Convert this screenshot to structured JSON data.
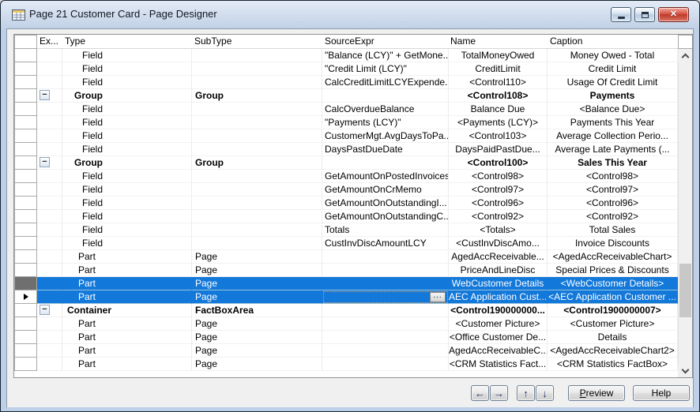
{
  "window": {
    "title": "Page 21 Customer Card - Page Designer"
  },
  "icons": {
    "app": "table-grid",
    "minimize": "minimize-bar",
    "restore": "restore-box",
    "close": "✕",
    "collapse": "−",
    "current_row": "right-triangle",
    "assist_edit": "...",
    "move_left": "←",
    "move_right": "→",
    "move_up": "↑",
    "move_down": "↓",
    "scroll_up": "chevron-up",
    "scroll_down": "chevron-down"
  },
  "colors": {
    "selection": "#1278da",
    "selection_text": "#ffffff",
    "titlebar_top": "#e3ebf6",
    "titlebar_bottom": "#c2d1e6",
    "frame": "#bdd0e7",
    "close_button": "#c73c2c",
    "client_bg": "#f0f0f0"
  },
  "grid": {
    "columns": [
      {
        "key": "ex",
        "label": "Ex..."
      },
      {
        "key": "type",
        "label": "Type"
      },
      {
        "key": "subtype",
        "label": "SubType"
      },
      {
        "key": "source",
        "label": "SourceExpr"
      },
      {
        "key": "name",
        "label": "Name"
      },
      {
        "key": "caption",
        "label": "Caption"
      }
    ],
    "rows": [
      {
        "type": "Field",
        "subtype": "",
        "source": "\"Balance (LCY)\" + GetMone...",
        "name": "TotalMoneyOwed",
        "caption": "Money Owed - Total"
      },
      {
        "type": "Field",
        "subtype": "",
        "source": "\"Credit Limit (LCY)\"",
        "name": "CreditLimit",
        "caption": "Credit Limit"
      },
      {
        "type": "Field",
        "subtype": "",
        "source": "CalcCreditLimitLCYExpende...",
        "name": "<Control110>",
        "caption": "Usage Of Credit Limit"
      },
      {
        "type": "Group",
        "subtype": "Group",
        "source": "",
        "name": "<Control108>",
        "caption": "Payments",
        "bold": true,
        "expand": true
      },
      {
        "type": "Field",
        "subtype": "",
        "source": "CalcOverdueBalance",
        "name": "Balance Due",
        "caption": "<Balance Due>"
      },
      {
        "type": "Field",
        "subtype": "",
        "source": "\"Payments (LCY)\"",
        "name": "<Payments (LCY)>",
        "caption": "Payments This Year"
      },
      {
        "type": "Field",
        "subtype": "",
        "source": "CustomerMgt.AvgDaysToPa...",
        "name": "<Control103>",
        "caption": "Average Collection Perio..."
      },
      {
        "type": "Field",
        "subtype": "",
        "source": "DaysPastDueDate",
        "name": "DaysPaidPastDue...",
        "caption": "Average Late Payments (..."
      },
      {
        "type": "Group",
        "subtype": "Group",
        "source": "",
        "name": "<Control100>",
        "caption": "Sales This Year",
        "bold": true,
        "expand": true
      },
      {
        "type": "Field",
        "subtype": "",
        "source": "GetAmountOnPostedInvoices",
        "name": "<Control98>",
        "caption": "<Control98>"
      },
      {
        "type": "Field",
        "subtype": "",
        "source": "GetAmountOnCrMemo",
        "name": "<Control97>",
        "caption": "<Control97>"
      },
      {
        "type": "Field",
        "subtype": "",
        "source": "GetAmountOnOutstandingI...",
        "name": "<Control96>",
        "caption": "<Control96>"
      },
      {
        "type": "Field",
        "subtype": "",
        "source": "GetAmountOnOutstandingC...",
        "name": "<Control92>",
        "caption": "<Control92>"
      },
      {
        "type": "Field",
        "subtype": "",
        "source": "Totals",
        "name": "<Totals>",
        "caption": "Total Sales"
      },
      {
        "type": "Field",
        "subtype": "",
        "source": "CustInvDiscAmountLCY",
        "name": "<CustInvDiscAmo...",
        "caption": "Invoice Discounts"
      },
      {
        "type": "Part",
        "subtype": "Page",
        "source": "",
        "name": "AgedAccReceivable...",
        "caption": "<AgedAccReceivableChart>"
      },
      {
        "type": "Part",
        "subtype": "Page",
        "source": "",
        "name": "PriceAndLineDisc",
        "caption": "Special Prices & Discounts"
      },
      {
        "type": "Part",
        "subtype": "Page",
        "source": "",
        "name": "WebCustomer Details",
        "caption": "<WebCustomer Details>",
        "selected": true
      },
      {
        "type": "Part",
        "subtype": "Page",
        "source": "",
        "name": "AEC Application Cust...",
        "caption": "<AEC Application Customer ...",
        "selected": true,
        "current": true,
        "assist": true
      },
      {
        "type": "Container",
        "subtype": "FactBoxArea",
        "source": "",
        "name": "<Control190000000...",
        "caption": "<Control1900000007>",
        "bold": true,
        "expand": true
      },
      {
        "type": "Part",
        "subtype": "Page",
        "source": "",
        "name": "<Customer Picture>",
        "caption": "<Customer Picture>"
      },
      {
        "type": "Part",
        "subtype": "Page",
        "source": "",
        "name": "<Office Customer De...",
        "caption": "Details"
      },
      {
        "type": "Part",
        "subtype": "Page",
        "source": "",
        "name": "AgedAccReceivableC...",
        "caption": "<AgedAccReceivableChart2>"
      },
      {
        "type": "Part",
        "subtype": "Page",
        "source": "",
        "name": "<CRM Statistics Fact...",
        "caption": "<CRM Statistics FactBox>"
      }
    ]
  },
  "footer": {
    "preview": "Preview",
    "help": "Help"
  }
}
